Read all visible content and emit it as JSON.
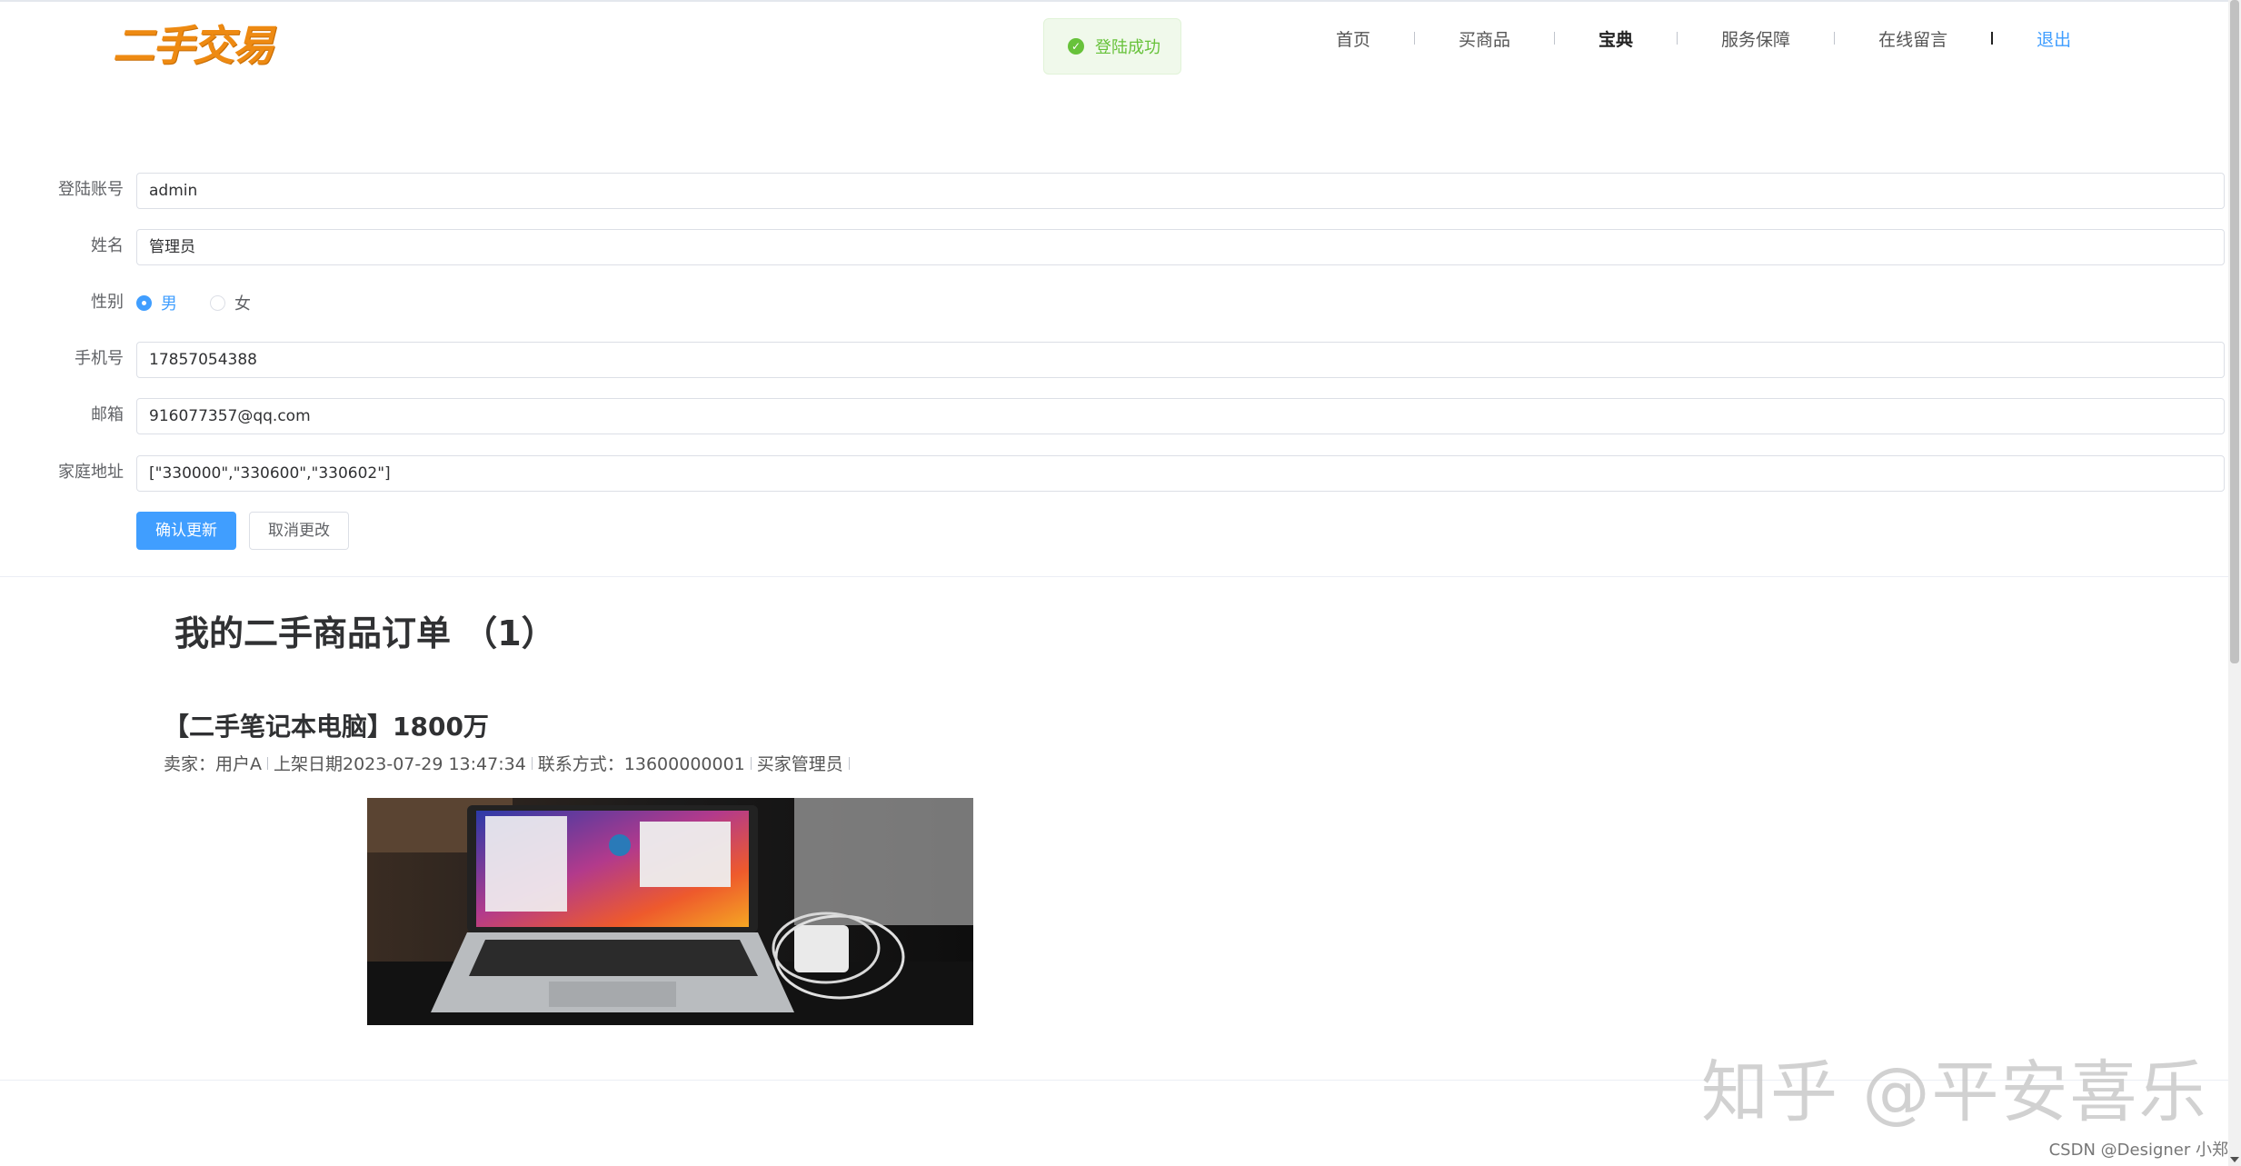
{
  "header": {
    "logo": "二手交易",
    "toast": "登陆成功",
    "nav": [
      "首页",
      "买商品",
      "宝典",
      "服务保障",
      "在线留言"
    ],
    "nav_active": "宝典",
    "logout": "退出"
  },
  "profile_form": {
    "account": {
      "label": "登陆账号",
      "value": "admin"
    },
    "name": {
      "label": "姓名",
      "value": "管理员"
    },
    "gender": {
      "label": "性别",
      "options": [
        "男",
        "女"
      ],
      "selected": "男"
    },
    "phone": {
      "label": "手机号",
      "value": "17857054388"
    },
    "email": {
      "label": "邮箱",
      "value": "916077357@qq.com"
    },
    "address": {
      "label": "家庭地址",
      "value": "[\"330000\",\"330600\",\"330602\"]"
    },
    "confirm_button": "确认更新",
    "cancel_button": "取消更改"
  },
  "orders": {
    "title": "我的二手商品订单 （1）",
    "items": [
      {
        "title": "【二手笔记本电脑】1800万",
        "seller": "卖家：用户A",
        "listed": "上架日期2023-07-29 13:47:34",
        "contact": "联系方式：13600000001",
        "buyer": "买家管理员",
        "image_icon": "laptop-photo"
      }
    ]
  },
  "watermark": "知乎 @平安喜乐",
  "credit": "CSDN @Designer 小郑",
  "colors": {
    "primary": "#409eff",
    "success": "#67c23a",
    "logo": "#ee8a12"
  }
}
